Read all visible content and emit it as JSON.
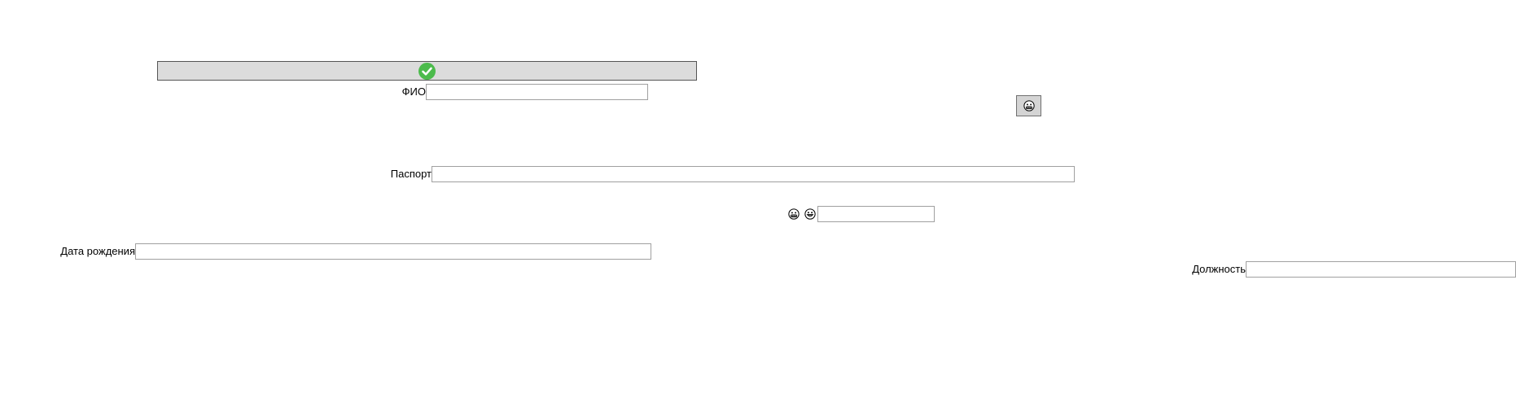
{
  "header": {
    "confirm_icon": "check-circle-icon",
    "confirm_color": "#4cbb4c"
  },
  "form": {
    "fio": {
      "label": "ФИО",
      "value": ""
    },
    "passport": {
      "label": "Паспорт",
      "value": ""
    },
    "emoji_field": {
      "value": "",
      "icons": [
        "grimace-emoji-icon",
        "grin-emoji-icon"
      ]
    },
    "birth_date": {
      "label": "Дата рождения",
      "value": ""
    },
    "position": {
      "label": "Должность",
      "value": ""
    }
  },
  "emoji_button": {
    "icon": "grimace-emoji-icon"
  }
}
